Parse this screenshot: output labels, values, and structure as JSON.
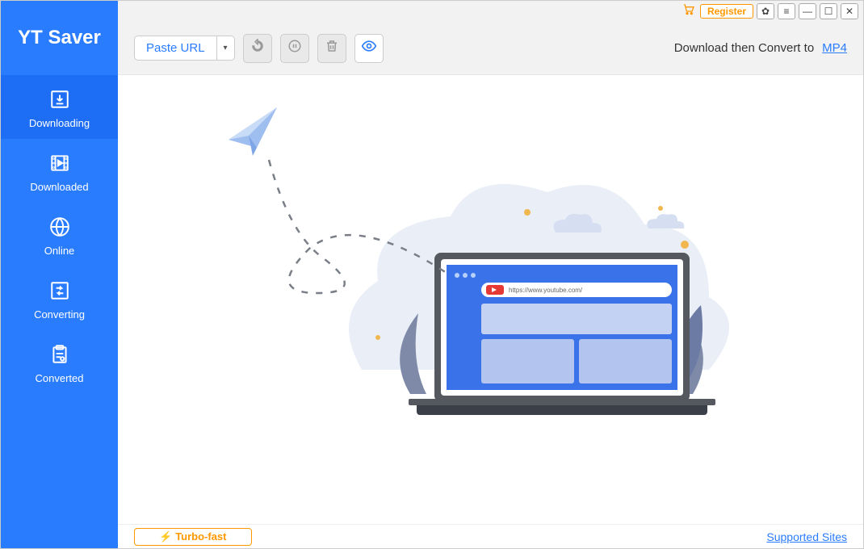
{
  "app_name": "YT Saver",
  "sidebar": {
    "items": [
      {
        "label": "Downloading"
      },
      {
        "label": "Downloaded"
      },
      {
        "label": "Online"
      },
      {
        "label": "Converting"
      },
      {
        "label": "Converted"
      }
    ]
  },
  "titlebar": {
    "register_label": "Register"
  },
  "toolbar": {
    "paste_label": "Paste URL",
    "convert_text": "Download then Convert to",
    "convert_format": "MP4"
  },
  "illustration": {
    "url_text": "https://www.youtube.com/"
  },
  "bottombar": {
    "turbo_label": "Turbo-fast",
    "supported_label": "Supported Sites"
  }
}
